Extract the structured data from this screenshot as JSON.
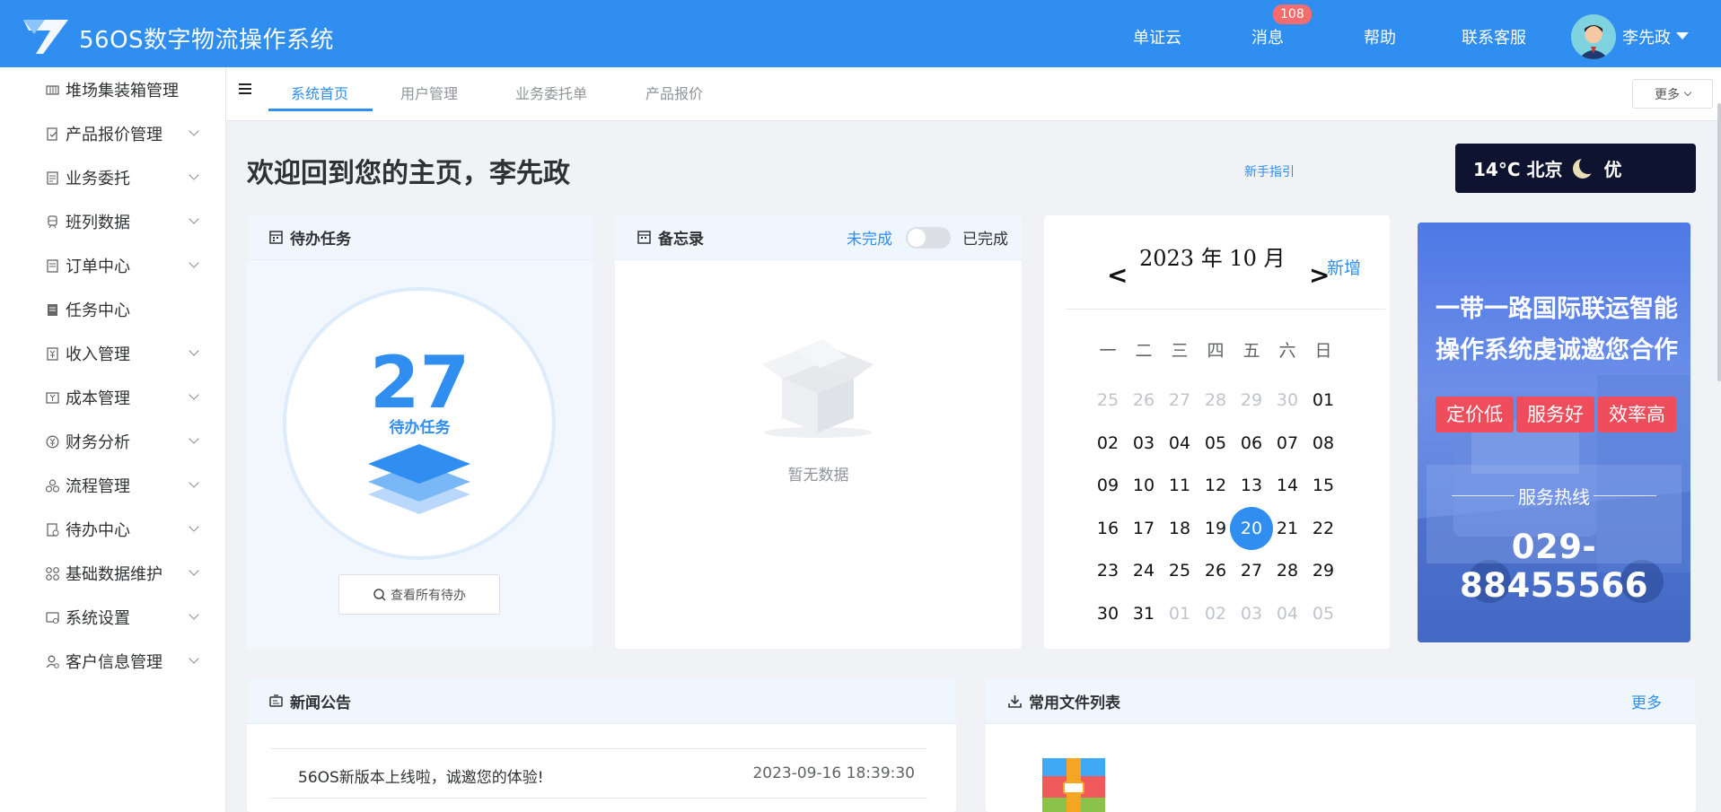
{
  "header": {
    "app_title": "56OS数字物流操作系统",
    "links": [
      "单证云",
      "消息",
      "帮助",
      "联系客服"
    ],
    "message_badge": "108",
    "user_name": "李先政"
  },
  "sidebar": {
    "items": [
      {
        "label": "堆场集装箱管理",
        "icon": "container-icon",
        "has_children": false
      },
      {
        "label": "产品报价管理",
        "icon": "quote-icon",
        "has_children": true
      },
      {
        "label": "业务委托",
        "icon": "delegate-icon",
        "has_children": true
      },
      {
        "label": "班列数据",
        "icon": "train-icon",
        "has_children": true
      },
      {
        "label": "订单中心",
        "icon": "order-icon",
        "has_children": true
      },
      {
        "label": "任务中心",
        "icon": "task-icon",
        "has_children": false
      },
      {
        "label": "收入管理",
        "icon": "income-icon",
        "has_children": true
      },
      {
        "label": "成本管理",
        "icon": "cost-icon",
        "has_children": true
      },
      {
        "label": "财务分析",
        "icon": "finance-icon",
        "has_children": true
      },
      {
        "label": "流程管理",
        "icon": "flow-icon",
        "has_children": true
      },
      {
        "label": "待办中心",
        "icon": "todo-icon",
        "has_children": true
      },
      {
        "label": "基础数据维护",
        "icon": "grid-icon",
        "has_children": true
      },
      {
        "label": "系统设置",
        "icon": "settings-icon",
        "has_children": true
      },
      {
        "label": "客户信息管理",
        "icon": "customer-icon",
        "has_children": true
      }
    ]
  },
  "tabs": {
    "items": [
      "系统首页",
      "用户管理",
      "业务委托单",
      "产品报价"
    ],
    "active": "系统首页",
    "more_label": "更多"
  },
  "welcome": {
    "title": "欢迎回到您的主页，李先政",
    "guide_link": "新手指引"
  },
  "weather": {
    "text": "14°C 北京",
    "air_quality": "优"
  },
  "todo_card": {
    "title": "待办任务",
    "count": "27",
    "count_label": "待办任务",
    "view_all": "查看所有待办"
  },
  "memo_card": {
    "title": "备忘录",
    "status_incomplete": "未完成",
    "status_complete": "已完成",
    "empty_text": "暂无数据"
  },
  "calendar": {
    "title": "2023 年 10 月",
    "prev": "<",
    "next": ">",
    "add_label": "新增",
    "weekdays": [
      "一",
      "二",
      "三",
      "四",
      "五",
      "六",
      "日"
    ],
    "days": [
      [
        "25",
        "26",
        "27",
        "28",
        "29",
        "30",
        "01"
      ],
      [
        "02",
        "03",
        "04",
        "05",
        "06",
        "07",
        "08"
      ],
      [
        "09",
        "10",
        "11",
        "12",
        "13",
        "14",
        "15"
      ],
      [
        "16",
        "17",
        "18",
        "19",
        "20",
        "21",
        "22"
      ],
      [
        "23",
        "24",
        "25",
        "26",
        "27",
        "28",
        "29"
      ],
      [
        "30",
        "31",
        "01",
        "02",
        "03",
        "04",
        "05"
      ]
    ],
    "today": "20"
  },
  "ad_banner": {
    "headline": "一带一路国际联运智能操作系统虔诚邀您合作",
    "tags": [
      "定价低",
      "服务好",
      "效率高"
    ],
    "hotline_label": "服务热线",
    "phone": "029-88455566"
  },
  "news_card": {
    "title": "新闻公告",
    "items": [
      {
        "title": "56OS新版本上线啦，诚邀您的体验!",
        "date": "2023-09-16 18:39:30"
      }
    ]
  },
  "files_card": {
    "title": "常用文件列表",
    "more_label": "更多"
  },
  "colors": {
    "primary": "#2f8ef0",
    "header_bg": "#2f8ef0",
    "badge": "#f56c6c",
    "ad_tag": "#f04d5c",
    "weather_bg": "#0e1330"
  }
}
